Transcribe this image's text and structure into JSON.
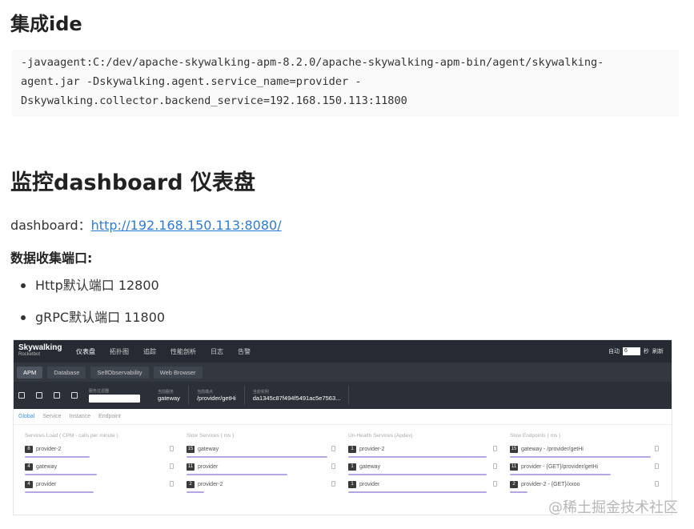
{
  "section1": {
    "title": "集成ide",
    "code_lines": [
      "-javaagent:C:/dev/apache-skywalking-apm-8.2.0/apache-skywalking-apm-bin/agent/skywalking-",
      "agent.jar -Dskywalking.agent.service_name=provider -",
      "Dskywalking.collector.backend_service=192.168.150.113:11800"
    ]
  },
  "section2": {
    "title": "监控dashboard 仪表盘",
    "dashboard_label": "dashboard：",
    "dashboard_link": "http://192.168.150.113:8080/",
    "ports_title": "数据收集端口:",
    "ports": [
      "Http默认端口 12800",
      "gRPC默认端口 11800"
    ]
  },
  "skywalking": {
    "logo": "Skywalking",
    "logo_sub": "Rocketbot",
    "nav": [
      "仪表盘",
      "拓扑图",
      "追踪",
      "性能剖析",
      "日志",
      "告警"
    ],
    "right_label": "自动",
    "right_box": "6",
    "right_sec": "秒",
    "right_refresh": "刷新",
    "tabs": [
      "APM",
      "Database",
      "SelfObservability",
      "Web Browser"
    ],
    "filter_label": "服务过滤器",
    "selects": [
      {
        "label": "当前服务",
        "value": "gateway"
      },
      {
        "label": "当前端点",
        "value": "/provider/getHi"
      },
      {
        "label": "当前实例",
        "value": "da1345c87f494f5491ac5e7563..."
      }
    ],
    "subtabs": [
      "Global",
      "Service",
      "Instance",
      "Endpoint"
    ],
    "columns": [
      {
        "title": "Services Load ( CPM - calls per minute )",
        "rows": [
          {
            "badge": "8",
            "name": "provider-2",
            "fill": 0.45
          },
          {
            "badge": "4",
            "name": "gateway",
            "fill": 0.5
          },
          {
            "badge": "4",
            "name": "provider",
            "fill": 0.48
          }
        ]
      },
      {
        "title": "Slow Services ( ms )",
        "rows": [
          {
            "badge": "15",
            "name": "gateway",
            "fill": 0.98
          },
          {
            "badge": "11",
            "name": "provider",
            "fill": 0.7
          },
          {
            "badge": "2",
            "name": "provider-2",
            "fill": 0.12
          }
        ]
      },
      {
        "title": "Un-Health Services (Apdex)",
        "rows": [
          {
            "badge": "1",
            "name": "provider-2",
            "fill": 0.96
          },
          {
            "badge": "1",
            "name": "gateway",
            "fill": 0.96
          },
          {
            "badge": "1",
            "name": "provider",
            "fill": 0.96
          }
        ]
      },
      {
        "title": "Slow Endpoints ( ms )",
        "rows": [
          {
            "badge": "15",
            "name": "gateway - /provider/getHi",
            "fill": 0.98
          },
          {
            "badge": "11",
            "name": "provider - {GET}/provider/getHi",
            "fill": 0.7
          },
          {
            "badge": "2",
            "name": "provider-2 - {GET}/xxoo",
            "fill": 0.12
          }
        ]
      }
    ]
  },
  "watermark": "@稀土掘金技术社区"
}
